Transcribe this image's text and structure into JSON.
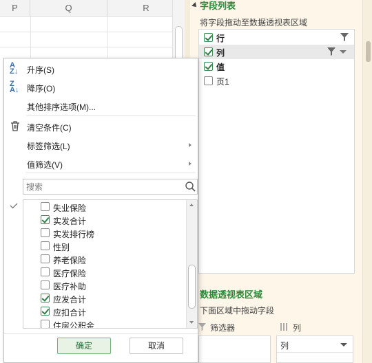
{
  "sheet": {
    "columns": [
      "P",
      "Q",
      "R"
    ]
  },
  "pane": {
    "field_list_title": "字段列表",
    "field_list_hint": "将字段拖动至数据透视表区域",
    "fields": [
      {
        "label": "行",
        "checked": true,
        "filter": true,
        "bold": true
      },
      {
        "label": "列",
        "checked": true,
        "filter": true,
        "bold": true,
        "dropdown": true,
        "highlighted": true
      },
      {
        "label": "值",
        "checked": true,
        "filter": false,
        "bold": true
      },
      {
        "label": "页1",
        "checked": false,
        "filter": false,
        "bold": false
      }
    ],
    "area_title": "数据透视表区域",
    "area_hint": "下面区域中拖动字段",
    "filter_area_label": "筛选器",
    "column_area_label": "列",
    "column_area_value": "列"
  },
  "popup": {
    "menu": [
      {
        "icon": "sort-ascending-icon",
        "label": "升序(S)"
      },
      {
        "icon": "sort-descending-icon",
        "label": "降序(O)"
      },
      {
        "icon": "",
        "label": "其他排序选项(M)..."
      },
      {
        "icon": "trash-icon",
        "label": "清空条件(C)"
      },
      {
        "icon": "",
        "label": "标签筛选(L)",
        "submenu": true
      },
      {
        "icon": "",
        "label": "值筛选(V)",
        "submenu": true
      }
    ],
    "search_placeholder": "搜索",
    "values": [
      {
        "label": "失业保险",
        "checked": false
      },
      {
        "label": "实发合计",
        "checked": true
      },
      {
        "label": "实发排行榜",
        "checked": false
      },
      {
        "label": "性别",
        "checked": false
      },
      {
        "label": "养老保险",
        "checked": false
      },
      {
        "label": "医疗保险",
        "checked": false
      },
      {
        "label": "医疗补助",
        "checked": false
      },
      {
        "label": "应发合计",
        "checked": true
      },
      {
        "label": "应扣合计",
        "checked": true
      },
      {
        "label": "住房公积金",
        "checked": false
      }
    ],
    "ok_label": "确定",
    "cancel_label": "取消"
  },
  "colors": {
    "accent_green": "#2a8a3a",
    "pane_background": "#fdf6e9"
  }
}
